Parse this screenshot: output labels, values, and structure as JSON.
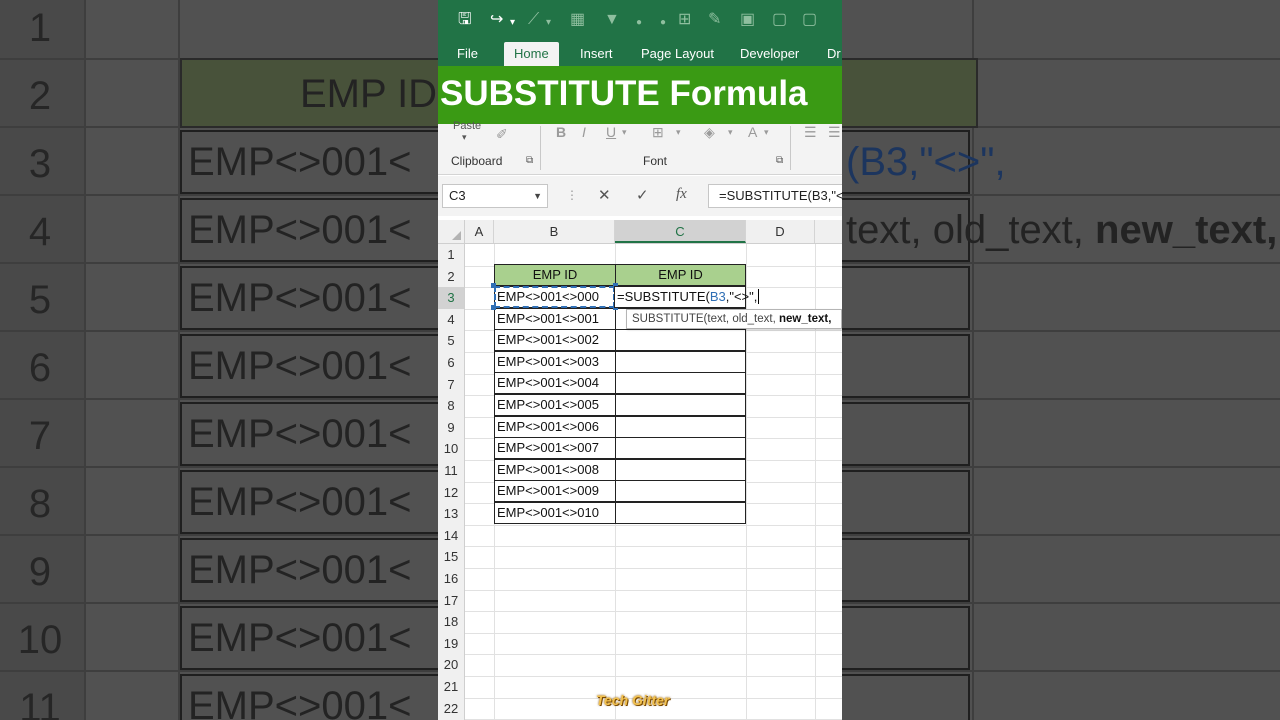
{
  "background": {
    "row_numbers": [
      "1",
      "2",
      "3",
      "4",
      "5",
      "6",
      "7",
      "8",
      "9",
      "10",
      "11"
    ],
    "header_text": "EMP ID",
    "cell_text": "EMP<>001<",
    "formula_fragment": "(B3,\"<>\",",
    "tooltip_fragment_plain": "text, old_text, ",
    "tooltip_fragment_bold": "new_text,"
  },
  "quick_access": {
    "icons": [
      "save-icon",
      "redo-icon",
      "dropdown-icon",
      "chart-icon",
      "sort-icon",
      "filter-icon",
      "dot-icon",
      "dot-icon",
      "insert-icon",
      "brush-icon",
      "comment-icon",
      "comment-icon"
    ]
  },
  "tabs": [
    {
      "label": "File",
      "active": false
    },
    {
      "label": "Home",
      "active": true
    },
    {
      "label": "Insert",
      "active": false
    },
    {
      "label": "Page Layout",
      "active": false
    },
    {
      "label": "Developer",
      "active": false
    },
    {
      "label": "Dr",
      "active": false
    }
  ],
  "banner": {
    "text": "SUBSTITUTE Formula",
    "color": "#3a9a14"
  },
  "ribbon": {
    "paste_label": "Paste",
    "clipboard_label": "Clipboard",
    "font_label": "Font",
    "bold": "B",
    "italic": "I",
    "underline": "U",
    "font_color": "A"
  },
  "formula_bar": {
    "name_box": "C3",
    "cancel": "✕",
    "enter": "✓",
    "fx": "fx",
    "formula": "=SUBSTITUTE(B3,\"<"
  },
  "columns": [
    "A",
    "B",
    "C",
    "D"
  ],
  "selected_column": "C",
  "rows": [
    "1",
    "2",
    "3",
    "4",
    "5",
    "6",
    "7",
    "8",
    "9",
    "10",
    "11",
    "12",
    "13",
    "14",
    "15",
    "16",
    "17",
    "18",
    "19",
    "20",
    "21",
    "22"
  ],
  "selected_row": "3",
  "table": {
    "header_b": "EMP ID",
    "header_c": "EMP ID",
    "header_color": "#a9d08e",
    "emp_ids": [
      "EMP<>001<>000",
      "EMP<>001<>001",
      "EMP<>001<>002",
      "EMP<>001<>003",
      "EMP<>001<>004",
      "EMP<>001<>005",
      "EMP<>001<>006",
      "EMP<>001<>007",
      "EMP<>001<>008",
      "EMP<>001<>009",
      "EMP<>001<>010"
    ]
  },
  "active_cell": {
    "prefix": "=SUBSTITUTE(",
    "ref": "B3",
    "suffix": ",\"<>\","
  },
  "tooltip": {
    "func": "SUBSTITUTE(",
    "plain": "text, old_text, ",
    "bold": "new_text,"
  },
  "watermark": "Tech Gitter",
  "accent_color": "#217346"
}
